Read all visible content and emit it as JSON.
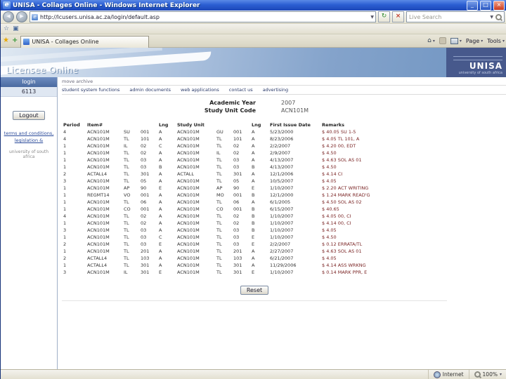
{
  "window": {
    "title": "UNISA - Collages Online - Windows Internet Explorer"
  },
  "browser": {
    "url": "http://lcusers.unisa.ac.za/login/default.asp",
    "search_placeholder": "Live Search",
    "tab": "UNISA - Collages Online",
    "page_menu": "Page",
    "tools_menu": "Tools",
    "status_zone": "Internet",
    "zoom": "100%"
  },
  "banner": {
    "site_title": "Licensee Online",
    "logo": "UNISA",
    "logo_sub": "university of south africa"
  },
  "nav": {
    "archive": "move archive",
    "links": [
      "student system functions",
      "admin documents",
      "web applications",
      "contact us",
      "advertising"
    ]
  },
  "sidebar": {
    "login_header": "login",
    "user_id": "6113",
    "logout_label": "Logout",
    "links": [
      "terms and conditions,",
      "legislation &"
    ],
    "note": "university of south africa"
  },
  "main": {
    "academic_year_label": "Academic Year",
    "academic_year_value": "2007",
    "study_unit_label": "Study Unit Code",
    "study_unit_value": "ACN101M",
    "reset_label": "Reset"
  },
  "table": {
    "headers": [
      "Period",
      "Item#",
      "",
      "",
      "Lng",
      "Study Unit",
      "",
      "",
      "Lng",
      "First Issue Date",
      "Remarks"
    ],
    "rows": [
      [
        "4",
        "ACN101M",
        "SU",
        "001",
        "A",
        "ACN101M",
        "GU",
        "001",
        "A",
        "5/23/2000",
        "$ 40.05 SU 1-5"
      ],
      [
        "4",
        "ACN101M",
        "TL",
        "101",
        "A",
        "ACN101M",
        "TL",
        "101",
        "A",
        "8/23/2006",
        "$ 4.05 TL 101, A"
      ],
      [
        "1",
        "ACN101M",
        "IL",
        "02",
        "C",
        "ACN101M",
        "TL",
        "02",
        "A",
        "2/2/2007",
        "$ 4.20 00, EDT"
      ],
      [
        "1",
        "ACN101M",
        "TL",
        "02",
        "A",
        "ACN101M",
        "IL",
        "02",
        "A",
        "2/9/2007",
        "$ 4.50"
      ],
      [
        "1",
        "ACN101M",
        "TL",
        "03",
        "A",
        "ACN101M",
        "TL",
        "03",
        "A",
        "4/13/2007",
        "$ 4.63 SOL AS 01"
      ],
      [
        "1",
        "ACN101M",
        "TL",
        "03",
        "B",
        "ACN101M",
        "TL",
        "03",
        "B",
        "4/13/2007",
        "$ 4.50"
      ],
      [
        "2",
        "ACTALL4",
        "TL",
        "301",
        "A",
        "ACTALL",
        "TL",
        "301",
        "A",
        "12/1/2006",
        "$ 4.14 CI"
      ],
      [
        "3",
        "ACN101M",
        "TL",
        "05",
        "A",
        "ACN101M",
        "TL",
        "05",
        "A",
        "10/5/2007",
        "$ 4.05"
      ],
      [
        "1",
        "ACN101M",
        "AP",
        "90",
        "E",
        "ACN101M",
        "AP",
        "90",
        "E",
        "1/10/2007",
        "$ 2.20 ACT WRITING"
      ],
      [
        "1",
        "REGMT14",
        "VO",
        "001",
        "A",
        "ACN101M",
        "MO",
        "001",
        "B",
        "12/1/2000",
        "$ 1.24 MARK READ'G"
      ],
      [
        "1",
        "ACN101M",
        "TL",
        "06",
        "A",
        "ACN101M",
        "TL",
        "06",
        "A",
        "6/1/2005",
        "$ 4.50 SOL AS 02"
      ],
      [
        "1",
        "ACN101M",
        "CO",
        "001",
        "A",
        "ACN101M",
        "CO",
        "001",
        "B",
        "6/15/2007",
        "$ 40.65"
      ],
      [
        "4",
        "ACN101M",
        "TL",
        "02",
        "A",
        "ACN101M",
        "TL",
        "02",
        "B",
        "1/10/2007",
        "$ 4.05 00, CI"
      ],
      [
        "1",
        "ACN101M",
        "TL",
        "02",
        "A",
        "ACN101M",
        "TL",
        "02",
        "B",
        "1/10/2007",
        "$ 4.14 00, CI"
      ],
      [
        "3",
        "ACN101M",
        "TL",
        "03",
        "A",
        "ACN101M",
        "TL",
        "03",
        "B",
        "1/10/2007",
        "$ 4.05"
      ],
      [
        "1",
        "ACN101M",
        "TL",
        "03",
        "C",
        "ACN101M",
        "TL",
        "03",
        "E",
        "1/10/2007",
        "$ 4.50"
      ],
      [
        "2",
        "ACN101M",
        "TL",
        "03",
        "E",
        "ACN101M",
        "TL",
        "03",
        "E",
        "2/2/2007",
        "$ 0.12 ERRATA/TL"
      ],
      [
        "1",
        "ACN101M",
        "TL",
        "201",
        "A",
        "ACN101M",
        "TL",
        "201",
        "A",
        "2/27/2007",
        "$ 4.63 SOL AS 01"
      ],
      [
        "2",
        "ACTALL4",
        "TL",
        "103",
        "A",
        "ACN101M",
        "TL",
        "103",
        "A",
        "6/21/2007",
        "$ 4.05"
      ],
      [
        "1",
        "ACTALL4",
        "TL",
        "301",
        "A",
        "ACN101M",
        "TL",
        "301",
        "A",
        "11/29/2006",
        "$ 4.14 ASS WRKNG"
      ],
      [
        "3",
        "ACN101M",
        "IL",
        "301",
        "E",
        "ACN101M",
        "TL",
        "301",
        "E",
        "1/10/2007",
        "$ 0.14 MARK PPR, E"
      ]
    ]
  }
}
